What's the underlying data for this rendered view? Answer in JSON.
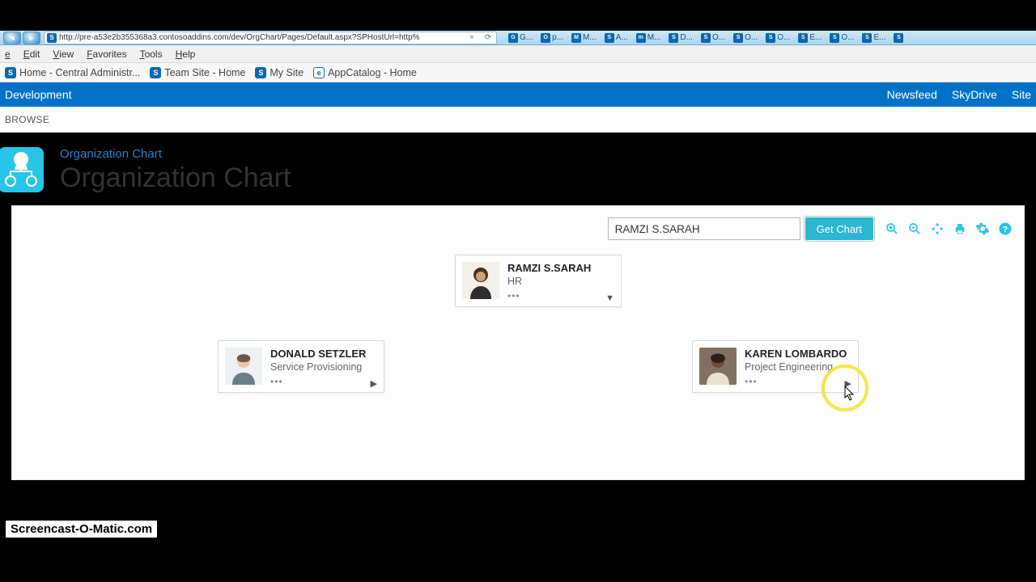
{
  "browser": {
    "url": "http://pre-a53e2b355368a3.contosoaddins.com/dev/OrgChart/Pages/Default.aspx?SPHostUrl=http%",
    "tabs": [
      {
        "icon": "G",
        "label": "G..."
      },
      {
        "icon": "O",
        "label": "p..."
      },
      {
        "icon": "M",
        "label": "M..."
      },
      {
        "icon": "S",
        "label": "A..."
      },
      {
        "icon": "m",
        "label": "M..."
      },
      {
        "icon": "S",
        "label": "D..."
      },
      {
        "icon": "S",
        "label": "O..."
      },
      {
        "icon": "S",
        "label": "O..."
      },
      {
        "icon": "S",
        "label": "O..."
      },
      {
        "icon": "S",
        "label": "E..."
      },
      {
        "icon": "S",
        "label": "O..."
      },
      {
        "icon": "S",
        "label": "E..."
      },
      {
        "icon": "S",
        "label": ""
      }
    ],
    "menus": [
      "e",
      "Edit",
      "View",
      "Favorites",
      "Tools",
      "Help"
    ],
    "favorites": [
      {
        "label": "Home - Central Administr..."
      },
      {
        "label": "Team Site - Home"
      },
      {
        "label": "My Site"
      },
      {
        "label": "AppCatalog - Home"
      }
    ]
  },
  "suite": {
    "left": "Development",
    "right": [
      "Newsfeed",
      "SkyDrive",
      "Site"
    ]
  },
  "browse_label": "BROWSE",
  "page": {
    "eyebrow": "Organization Chart",
    "title": "Organization Chart"
  },
  "toolbar": {
    "search_value": "RAMZI S.SARAH",
    "get_chart_label": "Get Chart"
  },
  "nodes": {
    "root": {
      "name": "RAMZI S.SARAH",
      "role": "HR",
      "expand": "▼"
    },
    "left": {
      "name": "DONALD SETZLER",
      "role": "Service Provisioning",
      "expand": "▶"
    },
    "right": {
      "name": "KAREN LOMBARDO",
      "role": "Project Engineering",
      "expand": "▶"
    }
  },
  "watermark": "Screencast-O-Matic.com"
}
